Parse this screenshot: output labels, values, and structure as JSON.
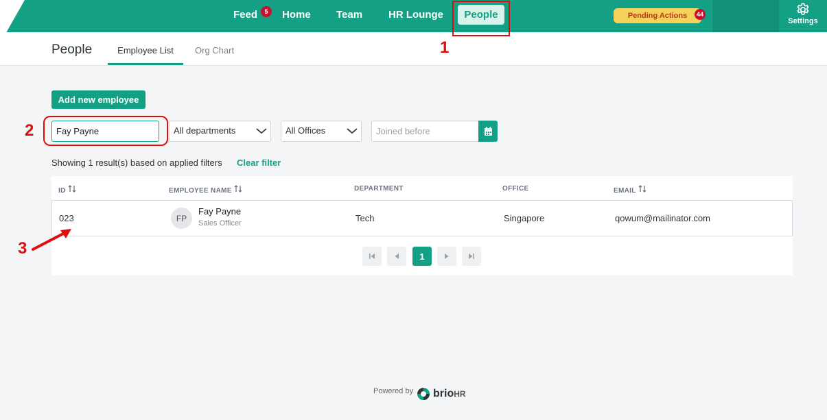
{
  "nav": {
    "items": [
      {
        "label": "Feed",
        "badge": "5"
      },
      {
        "label": "Home"
      },
      {
        "label": "Team"
      },
      {
        "label": "HR Lounge"
      },
      {
        "label": "People"
      }
    ],
    "pending_label": "Pending Actions",
    "pending_count": "44",
    "settings_label": "Settings"
  },
  "subheader": {
    "title": "People",
    "tabs": [
      {
        "label": "Employee List",
        "active": true
      },
      {
        "label": "Org Chart",
        "active": false
      }
    ]
  },
  "toolbar": {
    "add_label": "Add new employee",
    "search_value": "Fay Payne",
    "department_select": "All departments",
    "office_select": "All Offices",
    "joined_placeholder": "Joined before"
  },
  "results": {
    "summary": "Showing 1 result(s) based on applied filters",
    "clear_label": "Clear filter"
  },
  "table": {
    "headers": [
      "ID",
      "EMPLOYEE NAME",
      "DEPARTMENT",
      "OFFICE",
      "EMAIL"
    ],
    "rows": [
      {
        "id": "023",
        "initials": "FP",
        "name": "Fay Payne",
        "role": "Sales Officer",
        "department": "Tech",
        "office": "Singapore",
        "email": "qowum@mailinator.com"
      }
    ]
  },
  "pagination": {
    "current": "1"
  },
  "footer": {
    "powered_by": "Powered by",
    "brand": "brio",
    "brand_suffix": "HR"
  },
  "annotations": {
    "step1": "1",
    "step2": "2",
    "step3": "3",
    "color": "#e10d0d"
  },
  "colors": {
    "primary": "#14a085",
    "badge": "#c8102e",
    "pending_bg": "#f7d25a"
  }
}
